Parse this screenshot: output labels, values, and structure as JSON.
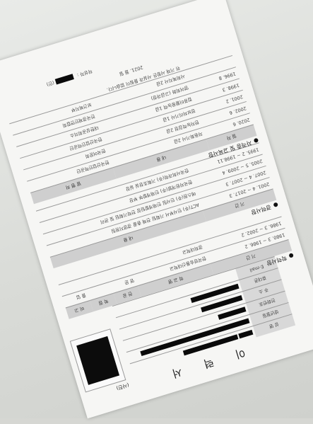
{
  "document": {
    "title": "이 력 서",
    "photo_label": "(사진)",
    "personal": {
      "labels": [
        "성 명",
        "생년월일",
        "전화번호",
        "주 소",
        "휴대폰",
        "E-mail"
      ]
    },
    "education": {
      "heading": "학력사항",
      "headers": [
        "기 간",
        "학 교 명",
        "전 공",
        "학 점",
        "비 고"
      ],
      "rows": [
        [
          "1980. 3 ~ 1986. 2",
          "한국방송통신대학교",
          "영 문",
          "",
          "졸 업"
        ],
        [
          "1986. 3 ~ 2002. 2",
          "경희대학교",
          "",
          "",
          ""
        ]
      ]
    },
    "career": {
      "heading": "경력사항",
      "headers": [
        "기 간",
        "내 용"
      ],
      "rows": [
        [
          "2001. 4 ~ 2017. 3",
          "ACT(주) 인사부서 기획팀 전체 총괄 경영지원팀"
        ],
        [
          "2007. 4 ~ 2007. 3",
          "에스원(주) 인사팀 인재개발팀장 전략기획팀 및 관리"
        ],
        [
          "2005. 5 ~ 2009. 4",
          "한국자원개발(주) 인재개발부 부장"
        ],
        [
          "1995. 2 ~ 1998.11",
          "한국사회과학(주) 기획조정실 실장"
        ]
      ]
    },
    "certificates": {
      "heading": "자격증 및 교육사항",
      "headers": [
        "일 자",
        "내 용",
        "발 행 처"
      ],
      "rows": [
        [
          "2020. 6",
          "자동화기사 2급",
          "한국산업인력공단"
        ],
        [
          "2002. 6",
          "한자능력검정 2급",
          "한국어문회"
        ],
        [
          "2001. 2",
          "정보처리기사 1급",
          "한국산업인력공단"
        ],
        [
          "1998. 3",
          "컴퓨터활용능력 1급",
          "대한상공회의소"
        ],
        [
          "1996. 8",
          "영어회화 (고급과정)",
          "전국경제인연합회"
        ],
        [
          "",
          "사회복지사 2급",
          "보건복지부"
        ]
      ]
    },
    "declaration": "위 기재 사항은 사실과 틀림이 없습니다.",
    "date": "2021.    월    일",
    "signature_label": "작성자 :",
    "signature_suffix": "(인)"
  }
}
